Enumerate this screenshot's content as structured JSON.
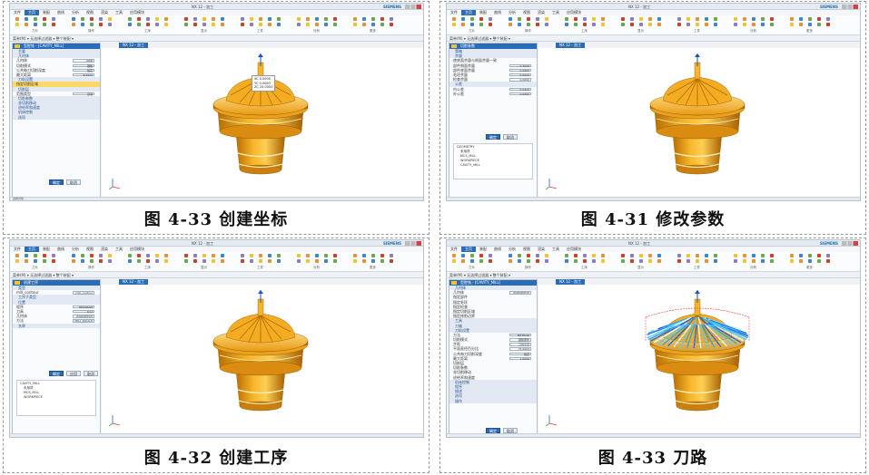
{
  "app": {
    "title": "NX 12 - 加工",
    "brand": "SIEMENS",
    "menu": [
      "文件",
      "主页",
      "装配",
      "曲线",
      "分析",
      "视图",
      "渲染",
      "工具",
      "应用模块"
    ],
    "command_bar": "菜单(M) ▾   无选择过滤器 ▾   整个装配 ▾",
    "ribbon_groups": [
      "刀片",
      "操作",
      "工序",
      "显示",
      "工件",
      "分析",
      "更多"
    ],
    "view_tab": "NX 12 - 加工"
  },
  "panels": [
    {
      "caption": "图 4-33 创建坐标",
      "panel_title": "型腔铣 - [CAVITY_MILL]",
      "rows": [
        {
          "label": "主要",
          "type": "section"
        },
        {
          "label": "几何体",
          "type": "section"
        },
        {
          "label": "几何体",
          "value": "WKB"
        },
        {
          "label": "切削模式",
          "value": "跟随"
        },
        {
          "label": "公共每刀切削深度",
          "value": "恒定"
        },
        {
          "label": "最大距离",
          "value": "8.0000"
        },
        {
          "label": "刀轨设置",
          "type": "section"
        },
        {
          "label": "指定切削区域",
          "type": "hl"
        },
        {
          "label": "切削层",
          "type": "section"
        },
        {
          "label": "范围类型",
          "value": "自动"
        },
        {
          "label": "切削参数",
          "type": "section"
        },
        {
          "label": "非切削移动",
          "type": "section"
        },
        {
          "label": "进给率和速度",
          "type": "section"
        },
        {
          "label": "机床控制",
          "type": "section"
        },
        {
          "label": "选项",
          "type": "section"
        }
      ],
      "buttons": [
        "确定",
        "取消"
      ],
      "tooltip": {
        "lines": [
          "XC  0.0000",
          "YC  0.0000",
          "ZC  25.0000"
        ]
      },
      "status": "选择对象",
      "toolpath": false
    },
    {
      "caption": "图 4-31 修改参数",
      "panel_title": "切削参数",
      "rows": [
        {
          "label": "策略",
          "type": "section"
        },
        {
          "label": "余量",
          "type": "section"
        },
        {
          "label": "使底面余量与侧面余量一致",
          "type": "check"
        },
        {
          "label": "部件侧面余量",
          "value": "0.3000"
        },
        {
          "label": "部件底面余量",
          "value": "0.0000"
        },
        {
          "label": "毛坯余量",
          "value": "0.0000"
        },
        {
          "label": "检查余量",
          "value": "0.0000"
        },
        {
          "label": "公差",
          "type": "section"
        },
        {
          "label": "内公差",
          "value": "0.0300"
        },
        {
          "label": "外公差",
          "value": "0.0300"
        }
      ],
      "buttons": [
        "确定",
        "取消"
      ],
      "tree": [
        "GEOMETRY",
        "未用项",
        "MCS_MILL",
        "WORKPIECE",
        "CAVITY_MILL"
      ],
      "status": "",
      "toolpath": false
    },
    {
      "caption": "图 4-32 创建工序",
      "panel_title": "创建工序",
      "rows": [
        {
          "label": "类型",
          "type": "section"
        },
        {
          "label": "mill_contour",
          "value": "mill_contour"
        },
        {
          "label": "工序子类型",
          "type": "section"
        },
        {
          "label": "位置",
          "type": "section"
        },
        {
          "label": "程序",
          "value": "PROGRAM"
        },
        {
          "label": "刀具",
          "value": "D12"
        },
        {
          "label": "几何体",
          "value": "WORKPIECE"
        },
        {
          "label": "方法",
          "value": "MILL_ROUGH"
        },
        {
          "label": "名称",
          "type": "section"
        }
      ],
      "buttons": [
        "确定",
        "应用",
        "取消"
      ],
      "tree": [
        "CAVITY_MILL",
        "未用项",
        "MCS_MILL",
        "WORKPIECE"
      ],
      "status": "",
      "toolpath": false
    },
    {
      "caption": "图 4-33 刀路",
      "panel_title": "型腔铣 - [CAVITY_MILL]",
      "rows": [
        {
          "label": "几何体",
          "type": "section"
        },
        {
          "label": "几何体",
          "value": "WORKPIECE"
        },
        {
          "label": "指定部件",
          "type": "plain"
        },
        {
          "label": "指定毛坯",
          "type": "plain"
        },
        {
          "label": "指定检查",
          "type": "plain"
        },
        {
          "label": "指定切削区域",
          "type": "plain"
        },
        {
          "label": "指定修剪边界",
          "type": "plain"
        },
        {
          "label": "工具",
          "type": "section"
        },
        {
          "label": "刀轴",
          "type": "section"
        },
        {
          "label": "刀轨设置",
          "type": "section"
        },
        {
          "label": "方法",
          "value": "METHOD"
        },
        {
          "label": "切削模式",
          "value": "跟随部件"
        },
        {
          "label": "步距",
          "value": "刀具平直"
        },
        {
          "label": "平面直径百分比",
          "value": "75.0000"
        },
        {
          "label": "公共每刀切削深度",
          "value": "恒定"
        },
        {
          "label": "最大距离",
          "value": "1.0000"
        },
        {
          "label": "切削层",
          "type": "plain"
        },
        {
          "label": "切削参数",
          "type": "plain"
        },
        {
          "label": "非切削移动",
          "type": "plain"
        },
        {
          "label": "进给率和速度",
          "type": "plain"
        },
        {
          "label": "机床控制",
          "type": "section"
        },
        {
          "label": "程序",
          "type": "section"
        },
        {
          "label": "描述",
          "type": "section"
        },
        {
          "label": "选项",
          "type": "section"
        },
        {
          "label": "操作",
          "type": "section"
        }
      ],
      "buttons": [
        "确定",
        "取消"
      ],
      "status": "",
      "toolpath": true
    }
  ]
}
